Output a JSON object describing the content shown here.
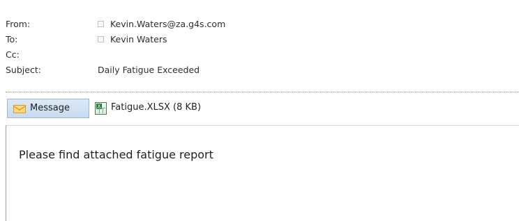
{
  "header": {
    "fields": [
      {
        "label": "From:",
        "value": "Kevin.Waters@za.g4s.com",
        "has_checkbox": true
      },
      {
        "label": "To:",
        "value": "Kevin Waters",
        "has_checkbox": true
      },
      {
        "label": "Cc:",
        "value": "",
        "has_checkbox": false
      },
      {
        "label": "Subject:",
        "value": "Daily Fatigue Exceeded",
        "has_checkbox": false
      }
    ]
  },
  "tabs": {
    "message_label": "Message",
    "attachment_label": "Fatigue.XLSX (8 KB)"
  },
  "body": {
    "text": "Please find attached fatigue report"
  },
  "icons": {
    "message_tab": "envelope-icon",
    "attachment": "excel-file-icon",
    "checkbox": "checkbox-icon"
  },
  "colors": {
    "message_tab_background": "#d6e6f7",
    "message_tab_border": "#9ab6d8",
    "body_border": "#9e9e9e"
  }
}
